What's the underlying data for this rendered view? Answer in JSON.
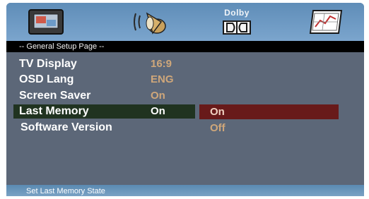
{
  "icon_bar": {
    "tabs": [
      {
        "icon": "tv-display-icon"
      },
      {
        "icon": "audio-speaker-icon"
      },
      {
        "icon": "dolby-icon",
        "label": "Dolby"
      },
      {
        "icon": "preference-chart-icon"
      }
    ]
  },
  "page": {
    "title": "-- General Setup Page --"
  },
  "settings": [
    {
      "label": "TV Display",
      "value": "16:9"
    },
    {
      "label": "OSD Lang",
      "value": "ENG"
    },
    {
      "label": "Screen Saver",
      "value": "On"
    },
    {
      "label": "Last Memory",
      "value": "On",
      "selected": true
    },
    {
      "label": "Software Version",
      "value": ""
    }
  ],
  "options": [
    {
      "label": "On",
      "selected": true
    },
    {
      "label": "Off",
      "selected": false
    }
  ],
  "status": {
    "text": "Set Last Memory State"
  },
  "colors": {
    "background": "#5c6778",
    "icon_bar": "#6e99c2",
    "header_strip": "#000000",
    "value_text": "#cfa77a",
    "row_highlight": "#203320",
    "option_highlight": "#681a1a"
  }
}
